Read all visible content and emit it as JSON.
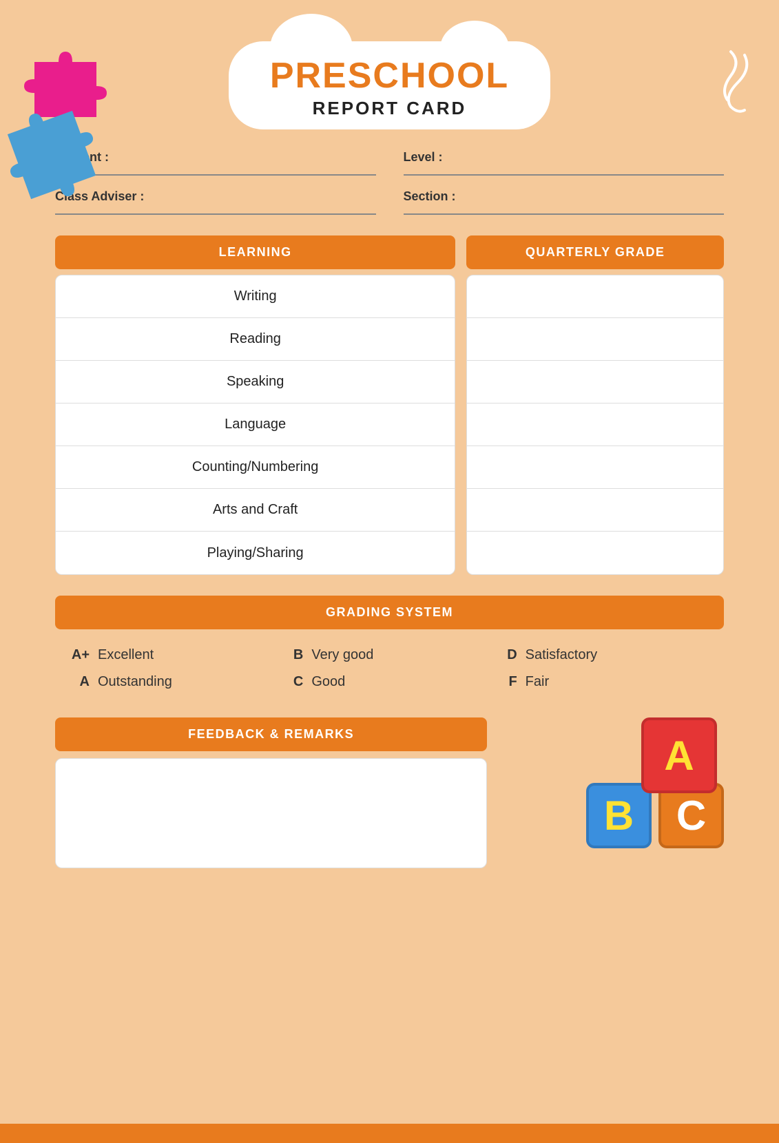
{
  "title": {
    "preschool": "PRESCHOOL",
    "report_card": "REPORT CARD"
  },
  "info": {
    "student_label": "Student :",
    "level_label": "Level :",
    "adviser_label": "Class Adviser :",
    "section_label": "Section :"
  },
  "table": {
    "learning_header": "LEARNING",
    "grade_header": "QUARTERLY GRADE",
    "rows": [
      {
        "subject": "Writing"
      },
      {
        "subject": "Reading"
      },
      {
        "subject": "Speaking"
      },
      {
        "subject": "Language"
      },
      {
        "subject": "Counting/Numbering"
      },
      {
        "subject": "Arts and Craft"
      },
      {
        "subject": "Playing/Sharing"
      }
    ]
  },
  "grading": {
    "header": "GRADING SYSTEM",
    "items": [
      {
        "letter": "A+",
        "description": "Excellent"
      },
      {
        "letter": "A",
        "description": "Outstanding"
      },
      {
        "letter": "B",
        "description": "Very good"
      },
      {
        "letter": "C",
        "description": "Good"
      },
      {
        "letter": "D",
        "description": "Satisfactory"
      },
      {
        "letter": "F",
        "description": "Fair"
      }
    ]
  },
  "feedback": {
    "header": "FEEDBACK & REMARKS"
  },
  "blocks": {
    "A": "A",
    "B": "B",
    "C": "C"
  }
}
